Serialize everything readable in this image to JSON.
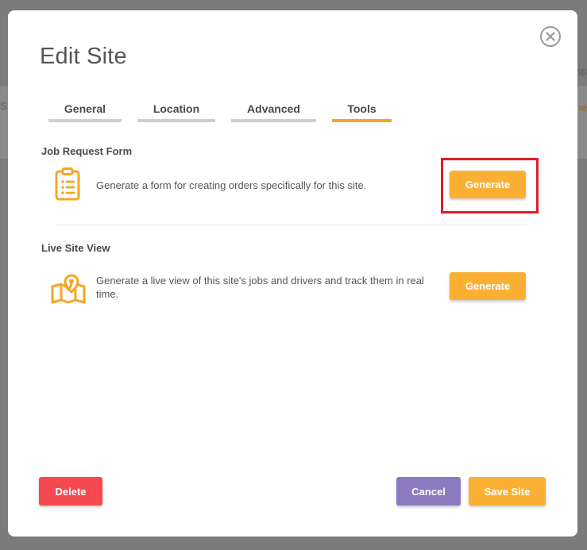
{
  "background": {
    "left_fragment": "S",
    "right_fragment_top": "sp",
    "right_fragment_bottom": "ne"
  },
  "modal": {
    "title": "Edit Site",
    "close_icon": "close-circle-icon"
  },
  "tabs": [
    {
      "label": "General",
      "active": false
    },
    {
      "label": "Location",
      "active": false
    },
    {
      "label": "Advanced",
      "active": false
    },
    {
      "label": "Tools",
      "active": true
    }
  ],
  "tools": {
    "job_request_form": {
      "heading": "Job Request Form",
      "icon": "clipboard-list-icon",
      "description": "Generate a form for creating orders specifically for this site.",
      "button_label": "Generate"
    },
    "live_site_view": {
      "heading": "Live Site View",
      "icon": "map-pin-icon",
      "description": "Generate a live view of this site's jobs and drivers and track them in real time.",
      "button_label": "Generate"
    }
  },
  "footer": {
    "delete_label": "Delete",
    "cancel_label": "Cancel",
    "save_label": "Save Site"
  },
  "colors": {
    "accent": "#f6a623",
    "button_orange": "#fbb034",
    "delete_red": "#f44a4f",
    "cancel_purple": "#8c7ac0",
    "highlight_red": "#dd1d2a"
  }
}
